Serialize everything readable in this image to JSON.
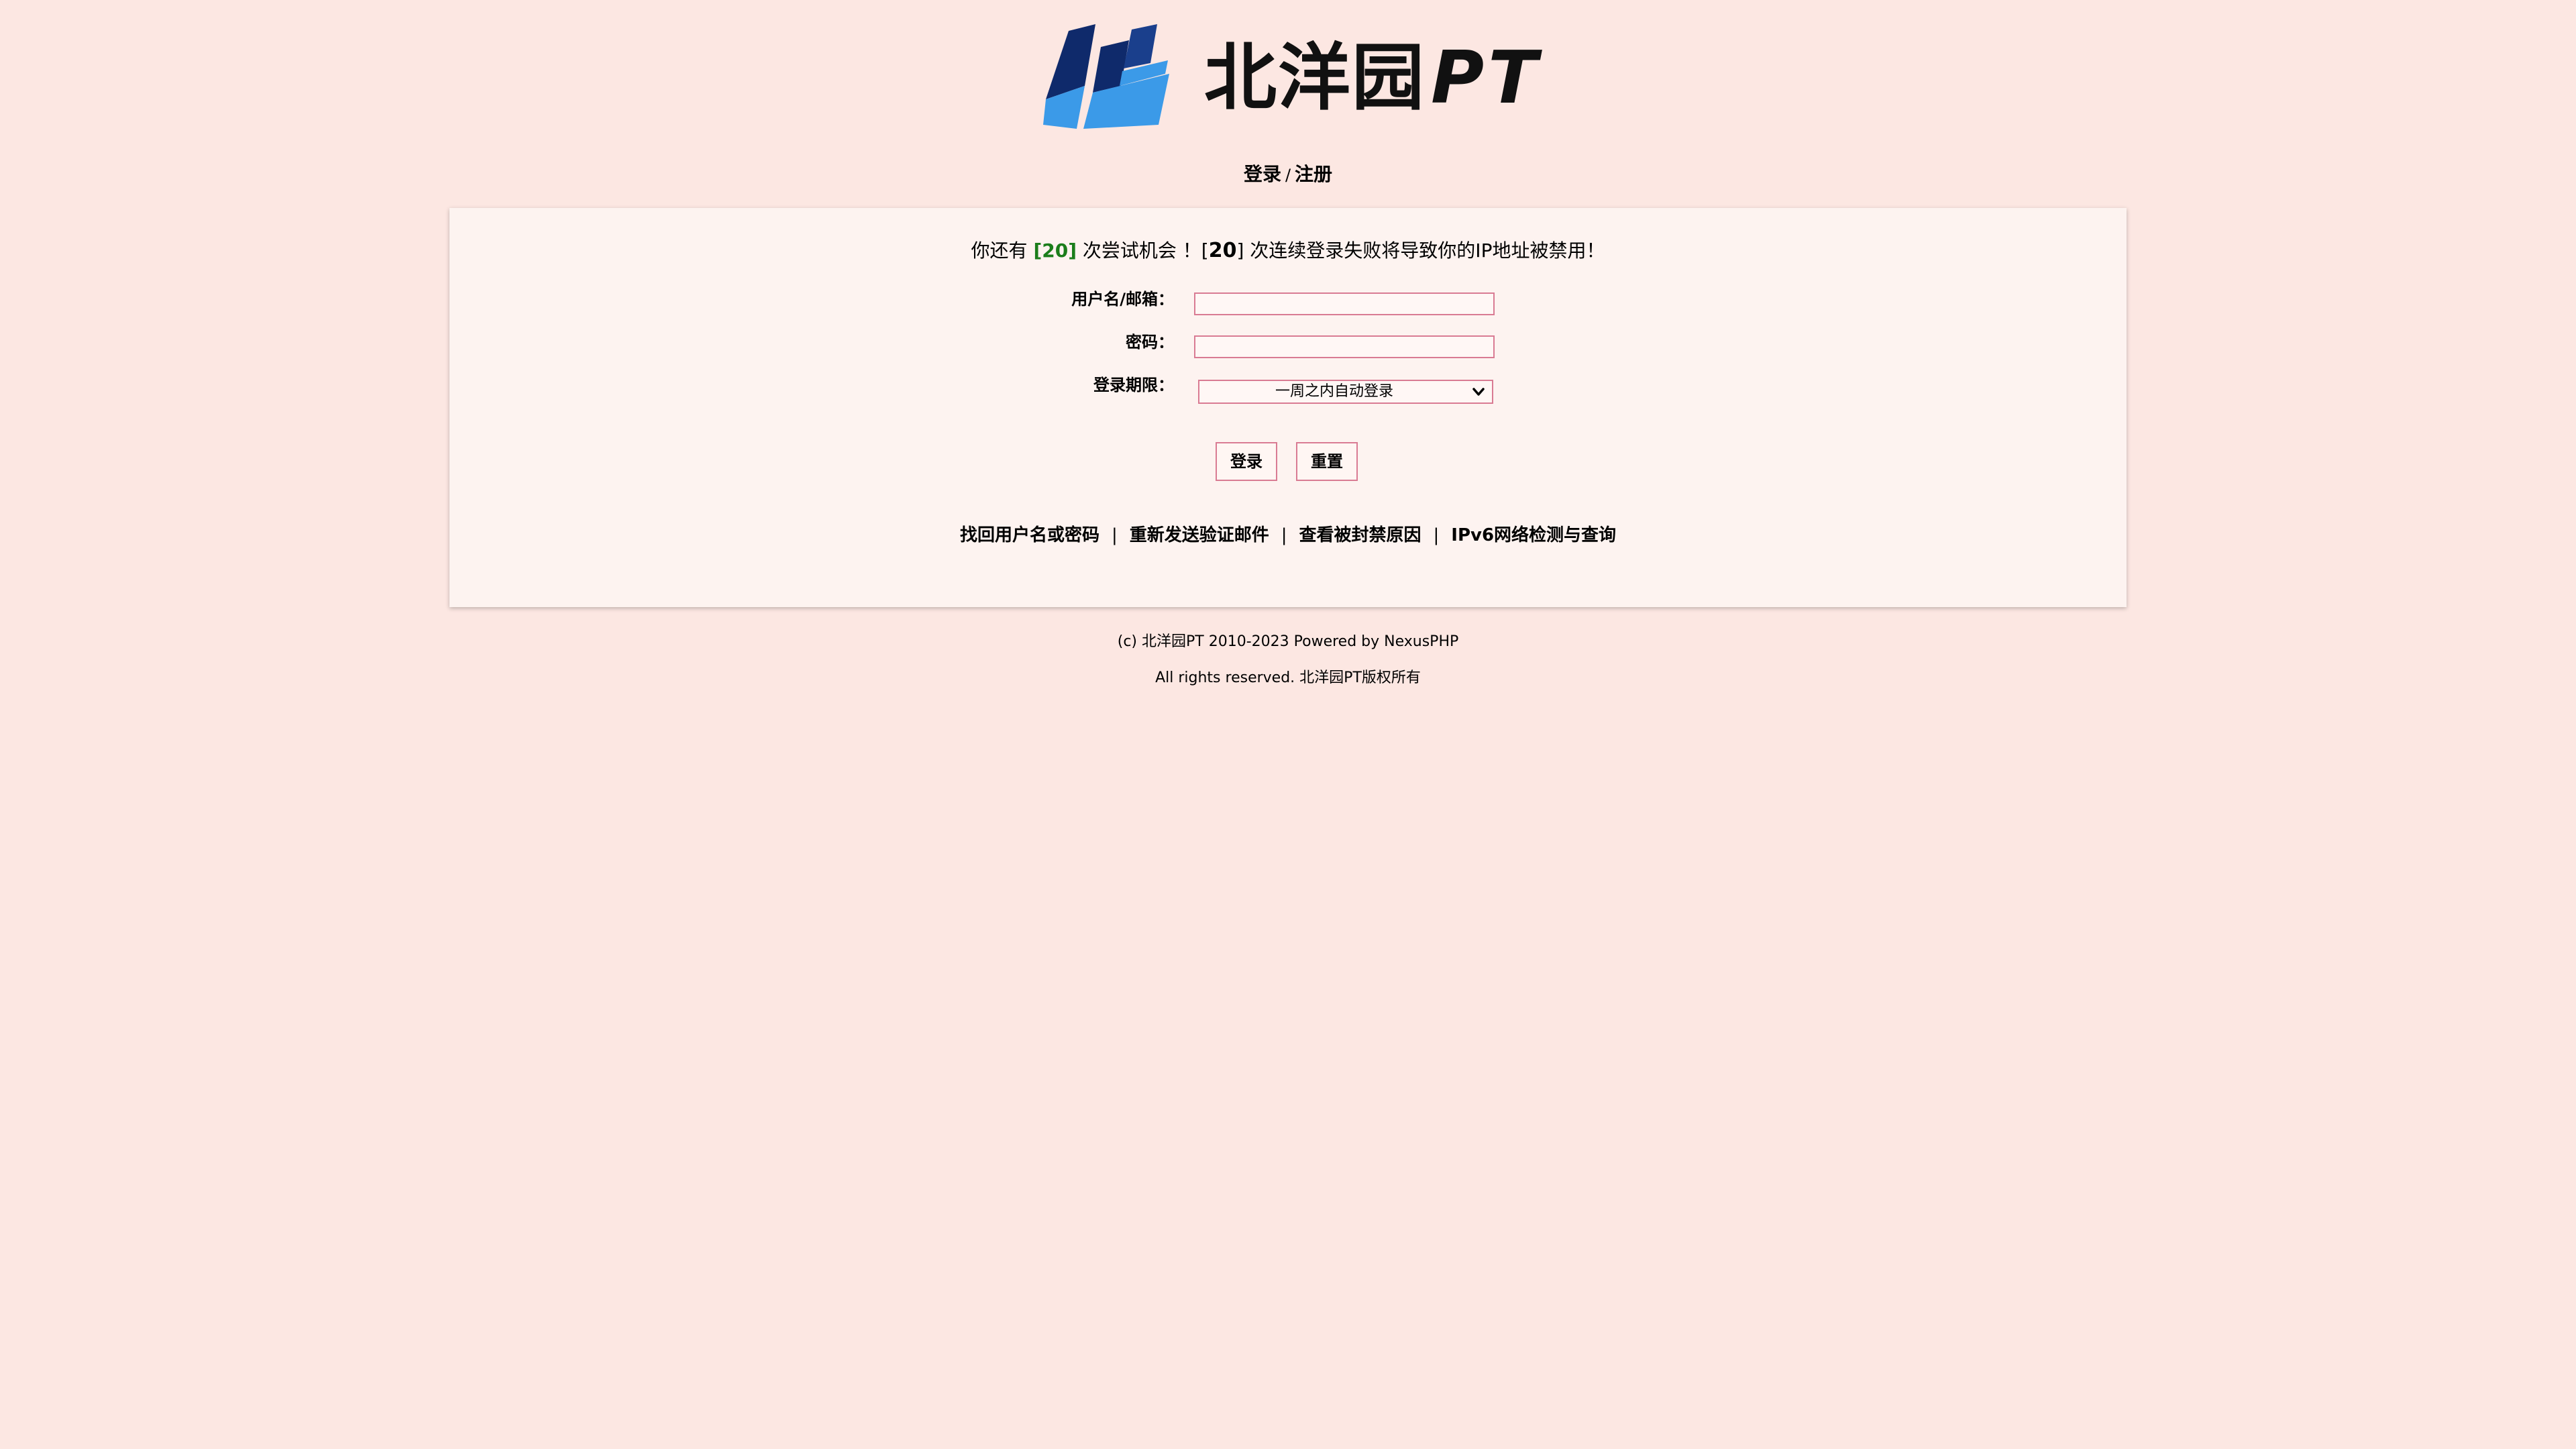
{
  "logo": {
    "text": "北洋园",
    "suffix": "PT",
    "colors": {
      "dark": "#0f2a6b",
      "light": "#3b9ae8"
    }
  },
  "auth_nav": {
    "login": "登录",
    "separator": "/",
    "register": "注册"
  },
  "warning": {
    "prefix": "你还有",
    "attempts_left": "[20]",
    "middle": "次尝试机会 ！[",
    "max_attempts": "20",
    "suffix": "] 次连续登录失败将导致你的IP地址被禁用！"
  },
  "form": {
    "username_label": "用户名/邮箱：",
    "username_value": "",
    "password_label": "密码：",
    "password_value": "",
    "duration_label": "登录期限：",
    "duration_selected": "一周之内自动登录",
    "login_button": "登录",
    "reset_button": "重置"
  },
  "links": {
    "recover": "找回用户名或密码",
    "resend": "重新发送验证邮件",
    "ban_reason": "查看被封禁原因",
    "ipv6": "IPv6网络检测与查询",
    "separator": "|"
  },
  "footer": {
    "copyright_prefix": "(c)",
    "site_link": "北洋园PT",
    "years": "2010-2023 Powered by",
    "powered_link": "NexusPHP",
    "rights": "All rights reserved.",
    "rights_cn": "北洋园PT版权所有"
  },
  "colors": {
    "background": "#fce7e2",
    "panel": "#fdf3f0",
    "input_border": "#d97b93",
    "accent_green": "#1b7d1b"
  }
}
